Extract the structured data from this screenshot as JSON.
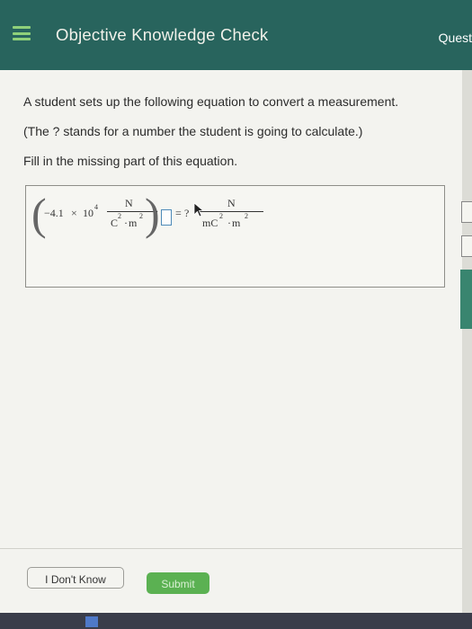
{
  "header": {
    "title": "Objective Knowledge Check",
    "quest_label": "Quest"
  },
  "question": {
    "line1": "A student sets up the following equation to convert a measurement.",
    "line2": "(The ? stands for a number the student is going to calculate.)",
    "line3": "Fill in the missing part of this equation."
  },
  "equation": {
    "coefficient": "−4.1",
    "times": "×",
    "base": "10",
    "exponent": "4",
    "lhs_unit_numerator": "N",
    "lhs_unit_denominator_c": "C",
    "lhs_unit_denominator_c_exp": "2",
    "lhs_unit_denominator_dot": "·",
    "lhs_unit_denominator_m": "m",
    "lhs_unit_denominator_m_exp": "2",
    "dot": "·",
    "equals": "=",
    "unknown": "?",
    "rhs_unit_numerator": "N",
    "rhs_unit_denominator_mc": "mC",
    "rhs_unit_denominator_mc_exp": "2",
    "rhs_unit_denominator_dot": "·",
    "rhs_unit_denominator_m": "m",
    "rhs_unit_denominator_m_exp": "2"
  },
  "buttons": {
    "dont_know": "I Don't Know",
    "submit": "Submit"
  },
  "colors": {
    "header_bg": "#28645d",
    "menu_icon": "#8fd07a",
    "submit_bg": "#5bb152"
  }
}
